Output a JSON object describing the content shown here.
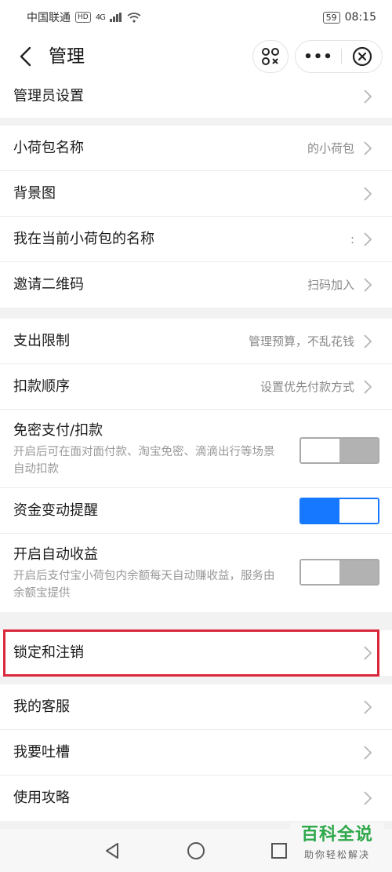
{
  "status_bar": {
    "carrier": "中国联通",
    "hd": "HD",
    "signal": "4G",
    "battery": "59",
    "time": "08:15"
  },
  "nav": {
    "title": "管理"
  },
  "groups": [
    {
      "rows": [
        {
          "label": "管理员设置",
          "value": ""
        }
      ]
    },
    {
      "rows": [
        {
          "label": "小荷包名称",
          "value": "的小荷包"
        },
        {
          "label": "背景图",
          "value": ""
        },
        {
          "label": "我在当前小荷包的名称",
          "value": ":"
        },
        {
          "label": "邀请二维码",
          "value": "扫码加入"
        }
      ]
    },
    {
      "rows": [
        {
          "label": "支出限制",
          "value": "管理预算，不乱花钱"
        },
        {
          "label": "扣款顺序",
          "value": "设置优先付款方式"
        },
        {
          "label": "免密支付/扣款",
          "desc": "开启后可在面对面付款、淘宝免密、滴滴出行等场景自动扣款",
          "toggle_on": false
        },
        {
          "label": "资金变动提醒",
          "toggle_on": true
        },
        {
          "label": "开启自动收益",
          "desc": "开启后支付宝小荷包内余额每天自动赚收益，服务由余额宝提供",
          "toggle_on": false
        }
      ]
    },
    {
      "rows": [
        {
          "label": "锁定和注销",
          "value": ""
        }
      ]
    },
    {
      "rows": [
        {
          "label": "我的客服",
          "value": ""
        },
        {
          "label": "我要吐槽",
          "value": ""
        },
        {
          "label": "使用攻略",
          "value": ""
        }
      ]
    }
  ],
  "watermark": {
    "main": "百科全说",
    "sub": "助你轻松解决"
  },
  "colors": {
    "toggle_on": "#1677ff",
    "highlight": "#d9283c",
    "watermark": "#2ea84a"
  }
}
